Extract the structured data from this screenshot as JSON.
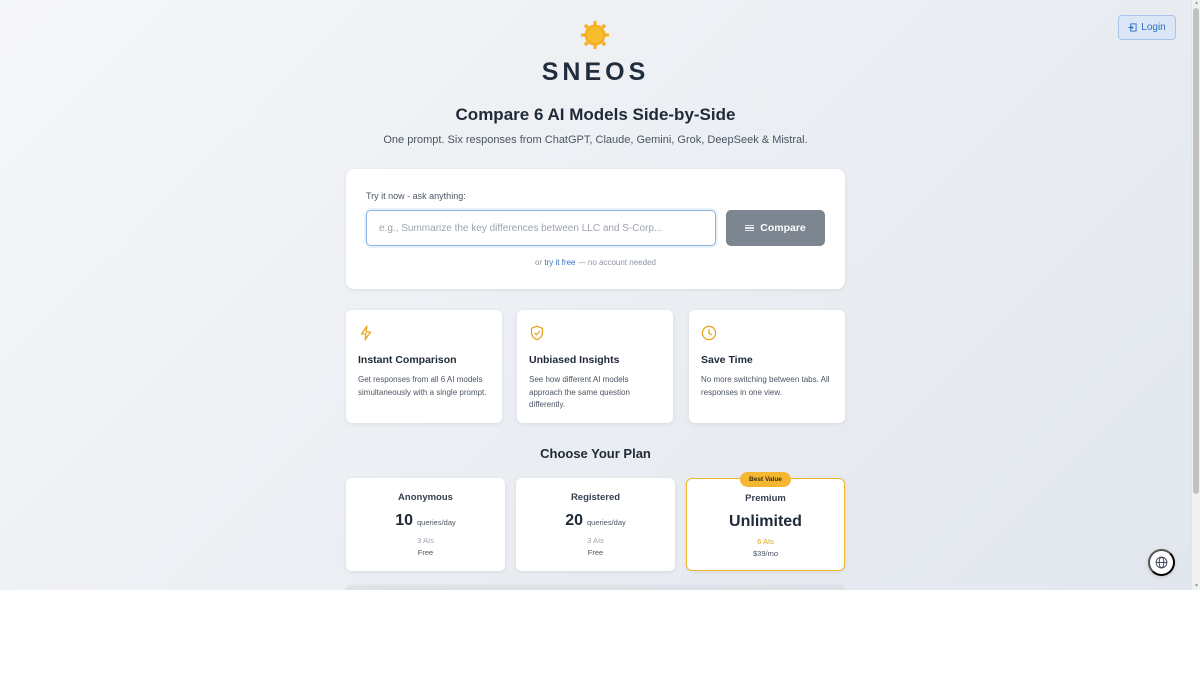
{
  "header": {
    "login_label": "Login",
    "login_icon": "login-icon",
    "brand": "SNEOS",
    "logo_icon": "sun-icon"
  },
  "hero": {
    "headline": "Compare 6 AI Models Side-by-Side",
    "subline": "One prompt. Six responses from ChatGPT, Claude, Gemini, Grok, DeepSeek & Mistral."
  },
  "try": {
    "label": "Try it now - ask anything:",
    "placeholder": "e.g., Summarize the key differences between LLC and S-Corp...",
    "value": "",
    "compare_label": "Compare",
    "footer_prefix": "or ",
    "footer_link": "try it free",
    "footer_suffix": " — no account needed"
  },
  "features": [
    {
      "icon": "lightning-icon",
      "title": "Instant Comparison",
      "desc": "Get responses from all 6 AI models simultaneously with a single prompt."
    },
    {
      "icon": "shield-check-icon",
      "title": "Unbiased Insights",
      "desc": "See how different AI models approach the same question differently."
    },
    {
      "icon": "clock-icon",
      "title": "Save Time",
      "desc": "No more switching between tabs. All responses in one view."
    }
  ],
  "plans": {
    "heading": "Choose Your Plan",
    "badge": "Best Value",
    "items": [
      {
        "name": "Anonymous",
        "number": "10",
        "unit": "queries/day",
        "ais": "3 AIs",
        "price": "Free"
      },
      {
        "name": "Registered",
        "number": "20",
        "unit": "queries/day",
        "ais": "3 AIs",
        "price": "Free"
      },
      {
        "name": "Premium",
        "big": "Unlimited",
        "ais": "6 AIs",
        "price": "$39/mo"
      }
    ]
  },
  "colors": {
    "accent": "#2f6fc4",
    "brand_yellow": "#f5b731",
    "compare_button": "#7d8591"
  },
  "language_icon": "globe-icon"
}
